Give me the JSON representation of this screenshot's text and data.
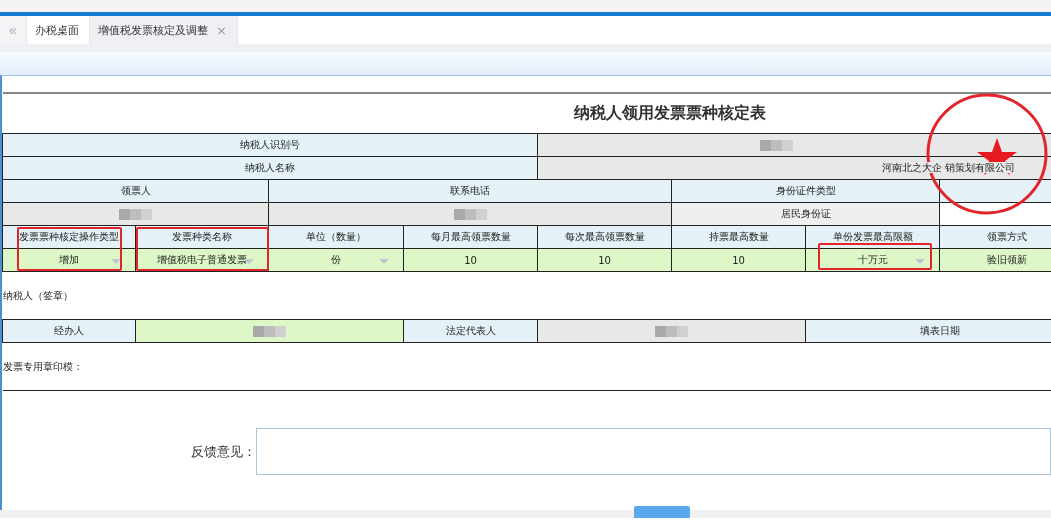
{
  "tabs": {
    "back": "«",
    "items": [
      {
        "label": "办税桌面",
        "selected": false,
        "closable": false
      },
      {
        "label": "增值税发票核定及调整",
        "selected": true,
        "closable": true,
        "close": "×"
      }
    ]
  },
  "form": {
    "title": "纳税人领用发票票种核定表",
    "taxpayer": [
      {
        "label": "纳税人识别号",
        "redacted": true
      },
      {
        "label": "纳税人名称",
        "value": "河南北之大企 销策划有限公司",
        "redacted": false
      }
    ],
    "recipient": [
      {
        "label": "领票人",
        "redacted": true
      },
      {
        "label": "联系电话",
        "redacted": true
      },
      {
        "label": "身份证件类型",
        "value": "居民身份证",
        "redacted": false
      }
    ],
    "invoice_columns": [
      {
        "header": "发票票种核定操作类型",
        "value": "增加",
        "kind": "select",
        "highlighted": true,
        "highlight_header": true
      },
      {
        "header": "发票种类名称",
        "value": "增值税电子普通发票",
        "kind": "select",
        "highlighted": true,
        "highlight_header": true
      },
      {
        "header": "单位（数量）",
        "value": "份",
        "kind": "select",
        "highlighted": false
      },
      {
        "header": "每月最高领票数量",
        "value": "10",
        "kind": "text",
        "highlighted": false
      },
      {
        "header": "每次最高领票数量",
        "value": "10",
        "kind": "text",
        "highlighted": false
      },
      {
        "header": "持票最高数量",
        "value": "10",
        "kind": "text",
        "highlighted": false
      },
      {
        "header": "单份发票最高限额",
        "value": "十万元",
        "kind": "select",
        "highlighted": true,
        "highlight_header": false
      },
      {
        "header": "领票方式",
        "value": "验旧领新",
        "kind": "text",
        "highlighted": false
      }
    ],
    "signature_label": "纳税人（签章）",
    "signers": [
      {
        "label": "经办人",
        "redacted": true,
        "editable": true
      },
      {
        "label": "法定代表人",
        "redacted": true,
        "editable": false
      },
      {
        "label": "填表日期"
      }
    ],
    "seal_label": "发票专用章印模："
  },
  "feedback": {
    "label": "反馈意见："
  },
  "actions": [
    {
      "kind": "button"
    }
  ]
}
